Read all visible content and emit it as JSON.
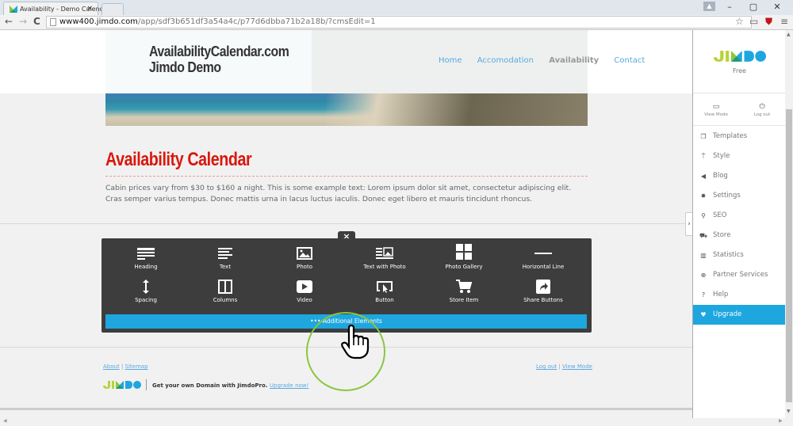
{
  "browser": {
    "tab_title": "Availability - Demo Calenc",
    "tab_close": "×",
    "url_host": "www400.jimdo.com",
    "url_path": "/app/sdf3b651df3a54a4c/p77d6dbba71b2a18b/?cmsEdit=1",
    "window_controls": {
      "minimize": "–",
      "maximize": "▢",
      "close": "✕"
    },
    "nav": {
      "back": "←",
      "forward": "→",
      "reload": "C"
    }
  },
  "site": {
    "title_line1": "AvailabilityCalendar.com",
    "title_line2": "Jimdo Demo",
    "nav": [
      {
        "label": "Home",
        "active": false
      },
      {
        "label": "Accomodation",
        "active": false
      },
      {
        "label": "Availability",
        "active": true
      },
      {
        "label": "Contact",
        "active": false
      }
    ],
    "heading": "Availability Calendar",
    "intro_line1": "Cabin prices vary from $30 to $160 a night. This is some example text: Lorem ipsum dolor sit amet, consectetur adipiscing elit.",
    "intro_line2": "Cras semper varius tempus. Donec mattis urna in lacus luctus iaculis. Donec eget libero et mauris tincidunt rhoncus."
  },
  "element_panel": {
    "close": "×",
    "elements": [
      {
        "label": "Heading",
        "icon": "heading-icon"
      },
      {
        "label": "Text",
        "icon": "text-icon"
      },
      {
        "label": "Photo",
        "icon": "photo-icon"
      },
      {
        "label": "Text with Photo",
        "icon": "text-with-photo-icon"
      },
      {
        "label": "Photo Gallery",
        "icon": "photo-gallery-icon"
      },
      {
        "label": "Horizontal Line",
        "icon": "horizontal-line-icon"
      },
      {
        "label": "Spacing",
        "icon": "spacing-icon"
      },
      {
        "label": "Columns",
        "icon": "columns-icon"
      },
      {
        "label": "Video",
        "icon": "video-icon"
      },
      {
        "label": "Button",
        "icon": "button-icon"
      },
      {
        "label": "Store Item",
        "icon": "store-item-icon"
      },
      {
        "label": "Share Buttons",
        "icon": "share-buttons-icon"
      }
    ],
    "more_label": "••• Additional Elements"
  },
  "footer": {
    "about": "About",
    "sitemap": "Sitemap",
    "divider": "|",
    "logout": "Log out",
    "view_mode": "View Mode",
    "promo_text": "Get your own Domain with JimdoPro.",
    "promo_link": "Upgrade now!"
  },
  "sidebar": {
    "plan": "Free",
    "view_mode": "View Mode",
    "log_out": "Log out",
    "expand": "›",
    "items": [
      {
        "label": "Templates",
        "icon": "templates-icon",
        "glyph": "❐"
      },
      {
        "label": "Style",
        "icon": "paint-roller-icon",
        "glyph": "⍑"
      },
      {
        "label": "Blog",
        "icon": "megaphone-icon",
        "glyph": "◀"
      },
      {
        "label": "Settings",
        "icon": "gear-icon",
        "glyph": "✹"
      },
      {
        "label": "SEO",
        "icon": "search-icon",
        "glyph": "⚲"
      },
      {
        "label": "Store",
        "icon": "cart-icon",
        "glyph": "⛟"
      },
      {
        "label": "Statistics",
        "icon": "bar-chart-icon",
        "glyph": "▥"
      },
      {
        "label": "Partner Services",
        "icon": "plus-circle-icon",
        "glyph": "⊕"
      },
      {
        "label": "Help",
        "icon": "help-icon",
        "glyph": "?"
      },
      {
        "label": "Upgrade",
        "icon": "heart-icon",
        "glyph": "♥",
        "highlighted": true
      }
    ]
  },
  "colors": {
    "accent_blue": "#1ea6df",
    "heading_red": "#d9170c",
    "link_blue": "#5aa9e0",
    "cursor_ring": "#8cc53f"
  }
}
